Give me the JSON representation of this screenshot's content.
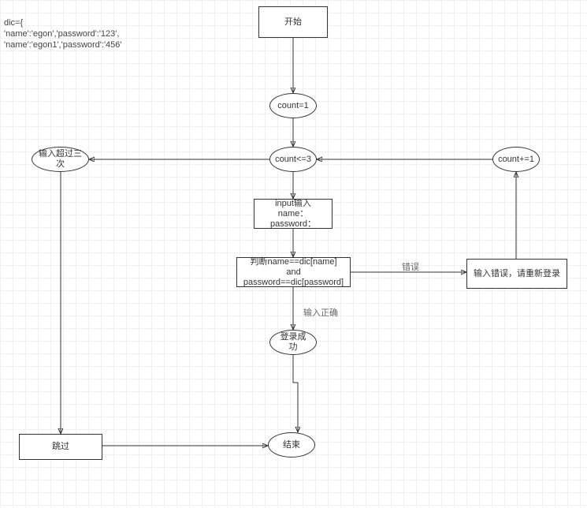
{
  "code": {
    "line1": "dic={",
    "line2": "'name':'egon','password':'123',",
    "line3": "'name':'egon1','password':'456'"
  },
  "nodes": {
    "start": "开始",
    "countInit": "count=1",
    "countCheck": "count<=3",
    "countInc": "count+=1",
    "inputExceeded": "输入超过三次",
    "inputPrompt": "input输入name：password：",
    "condition": "判断name==dic[name] and password==dic[password]",
    "errorMsg": "输入错误，请重新登录",
    "loginSuccess": "登录成功",
    "skip": "跳过",
    "end": "结束"
  },
  "labels": {
    "wrong": "错误",
    "correct": "输入正确"
  }
}
